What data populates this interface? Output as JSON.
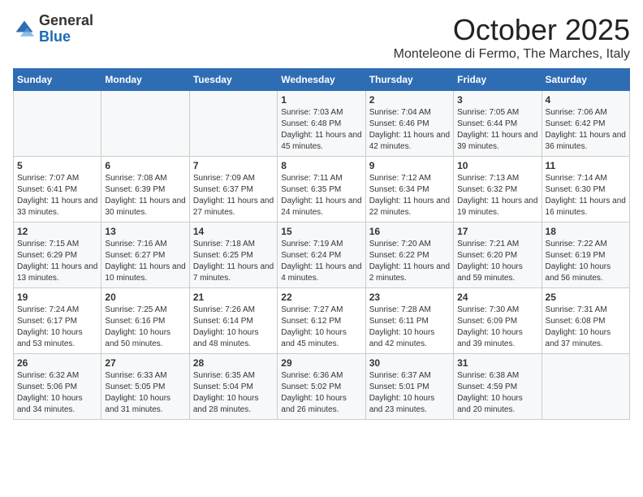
{
  "logo": {
    "general": "General",
    "blue": "Blue"
  },
  "title": "October 2025",
  "subtitle": "Monteleone di Fermo, The Marches, Italy",
  "headers": [
    "Sunday",
    "Monday",
    "Tuesday",
    "Wednesday",
    "Thursday",
    "Friday",
    "Saturday"
  ],
  "weeks": [
    [
      {
        "day": "",
        "info": ""
      },
      {
        "day": "",
        "info": ""
      },
      {
        "day": "",
        "info": ""
      },
      {
        "day": "1",
        "info": "Sunrise: 7:03 AM\nSunset: 6:48 PM\nDaylight: 11 hours and 45 minutes."
      },
      {
        "day": "2",
        "info": "Sunrise: 7:04 AM\nSunset: 6:46 PM\nDaylight: 11 hours and 42 minutes."
      },
      {
        "day": "3",
        "info": "Sunrise: 7:05 AM\nSunset: 6:44 PM\nDaylight: 11 hours and 39 minutes."
      },
      {
        "day": "4",
        "info": "Sunrise: 7:06 AM\nSunset: 6:42 PM\nDaylight: 11 hours and 36 minutes."
      }
    ],
    [
      {
        "day": "5",
        "info": "Sunrise: 7:07 AM\nSunset: 6:41 PM\nDaylight: 11 hours and 33 minutes."
      },
      {
        "day": "6",
        "info": "Sunrise: 7:08 AM\nSunset: 6:39 PM\nDaylight: 11 hours and 30 minutes."
      },
      {
        "day": "7",
        "info": "Sunrise: 7:09 AM\nSunset: 6:37 PM\nDaylight: 11 hours and 27 minutes."
      },
      {
        "day": "8",
        "info": "Sunrise: 7:11 AM\nSunset: 6:35 PM\nDaylight: 11 hours and 24 minutes."
      },
      {
        "day": "9",
        "info": "Sunrise: 7:12 AM\nSunset: 6:34 PM\nDaylight: 11 hours and 22 minutes."
      },
      {
        "day": "10",
        "info": "Sunrise: 7:13 AM\nSunset: 6:32 PM\nDaylight: 11 hours and 19 minutes."
      },
      {
        "day": "11",
        "info": "Sunrise: 7:14 AM\nSunset: 6:30 PM\nDaylight: 11 hours and 16 minutes."
      }
    ],
    [
      {
        "day": "12",
        "info": "Sunrise: 7:15 AM\nSunset: 6:29 PM\nDaylight: 11 hours and 13 minutes."
      },
      {
        "day": "13",
        "info": "Sunrise: 7:16 AM\nSunset: 6:27 PM\nDaylight: 11 hours and 10 minutes."
      },
      {
        "day": "14",
        "info": "Sunrise: 7:18 AM\nSunset: 6:25 PM\nDaylight: 11 hours and 7 minutes."
      },
      {
        "day": "15",
        "info": "Sunrise: 7:19 AM\nSunset: 6:24 PM\nDaylight: 11 hours and 4 minutes."
      },
      {
        "day": "16",
        "info": "Sunrise: 7:20 AM\nSunset: 6:22 PM\nDaylight: 11 hours and 2 minutes."
      },
      {
        "day": "17",
        "info": "Sunrise: 7:21 AM\nSunset: 6:20 PM\nDaylight: 10 hours and 59 minutes."
      },
      {
        "day": "18",
        "info": "Sunrise: 7:22 AM\nSunset: 6:19 PM\nDaylight: 10 hours and 56 minutes."
      }
    ],
    [
      {
        "day": "19",
        "info": "Sunrise: 7:24 AM\nSunset: 6:17 PM\nDaylight: 10 hours and 53 minutes."
      },
      {
        "day": "20",
        "info": "Sunrise: 7:25 AM\nSunset: 6:16 PM\nDaylight: 10 hours and 50 minutes."
      },
      {
        "day": "21",
        "info": "Sunrise: 7:26 AM\nSunset: 6:14 PM\nDaylight: 10 hours and 48 minutes."
      },
      {
        "day": "22",
        "info": "Sunrise: 7:27 AM\nSunset: 6:12 PM\nDaylight: 10 hours and 45 minutes."
      },
      {
        "day": "23",
        "info": "Sunrise: 7:28 AM\nSunset: 6:11 PM\nDaylight: 10 hours and 42 minutes."
      },
      {
        "day": "24",
        "info": "Sunrise: 7:30 AM\nSunset: 6:09 PM\nDaylight: 10 hours and 39 minutes."
      },
      {
        "day": "25",
        "info": "Sunrise: 7:31 AM\nSunset: 6:08 PM\nDaylight: 10 hours and 37 minutes."
      }
    ],
    [
      {
        "day": "26",
        "info": "Sunrise: 6:32 AM\nSunset: 5:06 PM\nDaylight: 10 hours and 34 minutes."
      },
      {
        "day": "27",
        "info": "Sunrise: 6:33 AM\nSunset: 5:05 PM\nDaylight: 10 hours and 31 minutes."
      },
      {
        "day": "28",
        "info": "Sunrise: 6:35 AM\nSunset: 5:04 PM\nDaylight: 10 hours and 28 minutes."
      },
      {
        "day": "29",
        "info": "Sunrise: 6:36 AM\nSunset: 5:02 PM\nDaylight: 10 hours and 26 minutes."
      },
      {
        "day": "30",
        "info": "Sunrise: 6:37 AM\nSunset: 5:01 PM\nDaylight: 10 hours and 23 minutes."
      },
      {
        "day": "31",
        "info": "Sunrise: 6:38 AM\nSunset: 4:59 PM\nDaylight: 10 hours and 20 minutes."
      },
      {
        "day": "",
        "info": ""
      }
    ]
  ]
}
